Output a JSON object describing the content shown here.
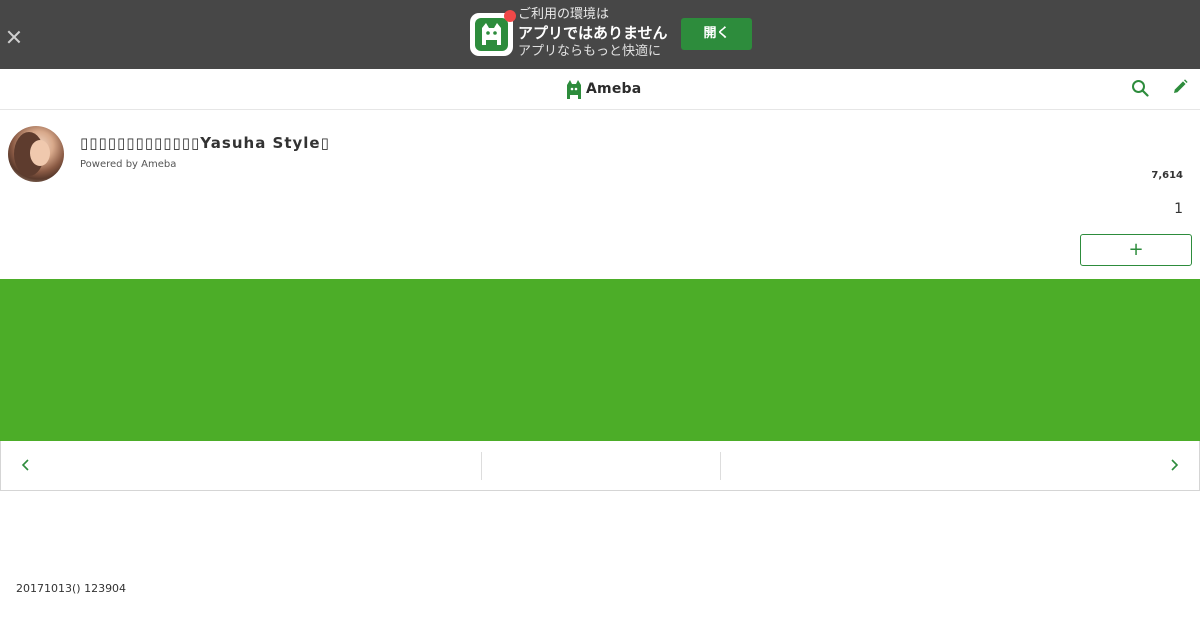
{
  "app_banner": {
    "line1": "ご利用の環境は",
    "line2": "アプリではありません",
    "line3": "アプリならもっと快適に",
    "open_label": "開く",
    "icon": "ameba-app-icon"
  },
  "header": {
    "logo_text": "Ameba",
    "search_icon": "search-icon",
    "edit_icon": "pencil-icon"
  },
  "profile": {
    "blog_title": "▯▯▯▯▯▯▯▯▯▯▯▯▯Yasuha Style▯",
    "powered_by": "Powered by Ameba",
    "reader_count": "7,614",
    "small_count": "1",
    "follow_label": "+"
  },
  "post": {
    "date": "20171013() 123904"
  },
  "colors": {
    "banner_bg": "#474747",
    "accent_green": "#2d8c3c",
    "hero_green": "#4cad28"
  }
}
